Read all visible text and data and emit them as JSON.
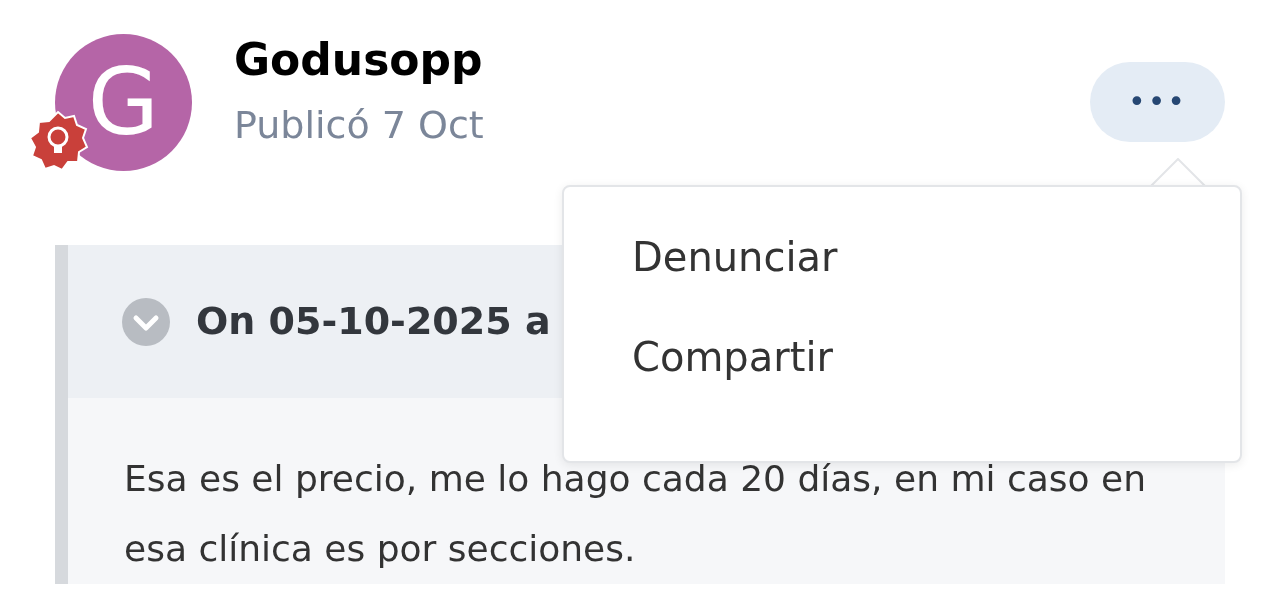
{
  "post": {
    "avatar_letter": "G",
    "author": "Godusopp",
    "posted": "Publicó 7 Oct"
  },
  "more_button": {
    "label": "•••",
    "expanded": true
  },
  "menu": {
    "items": [
      {
        "label": "Denunciar"
      },
      {
        "label": "Compartir"
      }
    ]
  },
  "quote": {
    "header": "On 05-10-2025 a",
    "collapsed": false,
    "text": "Esa es el precio, me lo hago cada 20 días, en mi caso en esa clínica es por secciones."
  }
}
